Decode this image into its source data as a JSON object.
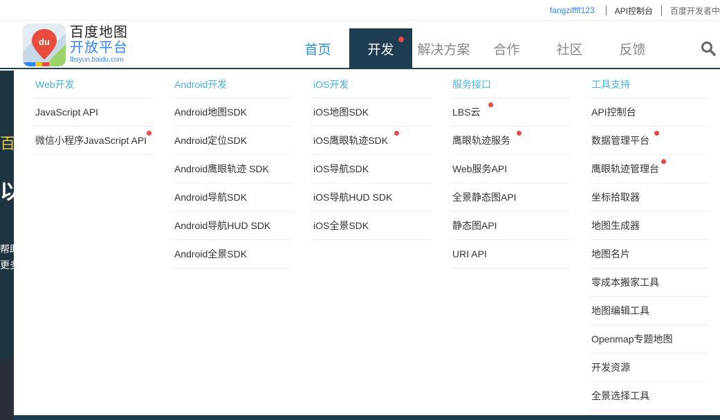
{
  "topbar": {
    "username": "fangziffff123",
    "api_console": "API控制台",
    "dev_center": "百度开发者中"
  },
  "logo": {
    "badge": "du",
    "line1": "百度地图",
    "line2": "开放平台",
    "domain": "lbsyun.baidu.com"
  },
  "nav": {
    "items": [
      {
        "label": "首页"
      },
      {
        "label": "开发"
      },
      {
        "label": "解决方案"
      },
      {
        "label": "合作"
      },
      {
        "label": "社区"
      },
      {
        "label": "反馈"
      }
    ]
  },
  "background": {
    "glyph1": "百",
    "glyph2": "以",
    "text1": "帮助",
    "text2": "更多"
  },
  "dropdown": {
    "columns": [
      {
        "title": "Web开发",
        "items": [
          {
            "label": "JavaScript API"
          },
          {
            "label": "微信小程序JavaScript API"
          }
        ]
      },
      {
        "title": "Android开发",
        "items": [
          {
            "label": "Android地图SDK"
          },
          {
            "label": "Android定位SDK"
          },
          {
            "label": "Android鹰眼轨迹 SDK"
          },
          {
            "label": "Android导航SDK"
          },
          {
            "label": "Android导航HUD SDK"
          },
          {
            "label": "Android全景SDK"
          }
        ]
      },
      {
        "title": "iOS开发",
        "items": [
          {
            "label": "iOS地图SDK"
          },
          {
            "label": "iOS鹰眼轨迹SDK"
          },
          {
            "label": "iOS导航SDK"
          },
          {
            "label": "iOS导航HUD SDK"
          },
          {
            "label": "iOS全景SDK"
          }
        ]
      },
      {
        "title": "服务接口",
        "items": [
          {
            "label": "LBS云"
          },
          {
            "label": "鹰眼轨迹服务"
          },
          {
            "label": "Web服务API"
          },
          {
            "label": "全景静态图API"
          },
          {
            "label": "静态图API"
          },
          {
            "label": "URI API"
          }
        ]
      },
      {
        "title": "工具支持",
        "items": [
          {
            "label": "API控制台"
          },
          {
            "label": "数据管理平台"
          },
          {
            "label": "鹰眼轨迹管理台"
          },
          {
            "label": "坐标拾取器"
          },
          {
            "label": "地图生成器"
          },
          {
            "label": "地图名片"
          },
          {
            "label": "零成本搬家工具"
          },
          {
            "label": "地图编辑工具"
          },
          {
            "label": "Openmap专题地图"
          },
          {
            "label": "开发资源"
          },
          {
            "label": "全景选择工具"
          }
        ]
      }
    ]
  },
  "colors": {
    "accent": "#3385ff",
    "nav_active": "#1e3d52",
    "column_title": "#4ab3de",
    "new_dot": "#e84a4a"
  }
}
